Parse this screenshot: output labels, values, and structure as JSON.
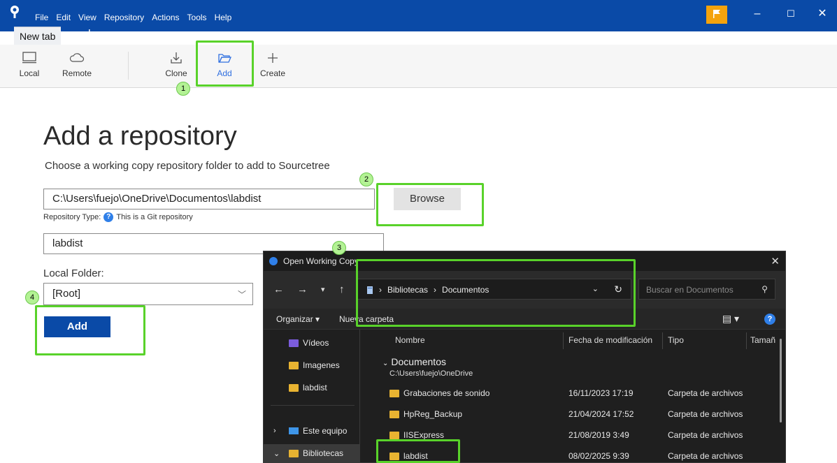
{
  "menu": [
    "File",
    "Edit",
    "View",
    "Repository",
    "Actions",
    "Tools",
    "Help"
  ],
  "tab": {
    "label": "New tab"
  },
  "toolbar": {
    "local": "Local",
    "remote": "Remote",
    "clone": "Clone",
    "add": "Add",
    "create": "Create"
  },
  "steps": [
    "1",
    "2",
    "3",
    "4"
  ],
  "main": {
    "title": "Add a repository",
    "subtitle": "Choose a working copy repository folder to add to Sourcetree",
    "path_value": "C:\\Users\\fuejo\\OneDrive\\Documentos\\labdist",
    "browse_label": "Browse",
    "repo_type_label": "Repository Type:",
    "repo_type_value": "This is a Git repository",
    "name_value": "labdist",
    "local_folder_label": "Local Folder:",
    "local_folder_value": "[Root]",
    "add_label": "Add"
  },
  "dialog": {
    "title": "Open Working Copy",
    "breadcrumbs": [
      "Bibliotecas",
      "Documentos"
    ],
    "search_placeholder": "Buscar en Documentos",
    "organize": "Organizar",
    "new_folder": "Nueva carpeta",
    "nav": {
      "videos": "Vídeos",
      "images": "Imagenes",
      "labdist": "labdist",
      "this_pc": "Este equipo",
      "libraries": "Bibliotecas"
    },
    "columns": {
      "name": "Nombre",
      "date": "Fecha de modificación",
      "type": "Tipo",
      "size": "Tamañ"
    },
    "group": {
      "name": "Documentos",
      "path": "C:\\Users\\fuejo\\OneDrive"
    },
    "rows": [
      {
        "name": "Grabaciones de sonido",
        "date": "16/11/2023 17:19",
        "type": "Carpeta de archivos"
      },
      {
        "name": "HpReg_Backup",
        "date": "21/04/2024 17:52",
        "type": "Carpeta de archivos"
      },
      {
        "name": "IISExpress",
        "date": "21/08/2019 3:49",
        "type": "Carpeta de archivos"
      },
      {
        "name": "labdist",
        "date": "08/02/2025 9:39",
        "type": "Carpeta de archivos"
      }
    ]
  },
  "colors": {
    "titlebar": "#0a4aa7",
    "accent": "#2f6fe0",
    "highlight": "#59d22a",
    "flag": "#f4a30d"
  }
}
